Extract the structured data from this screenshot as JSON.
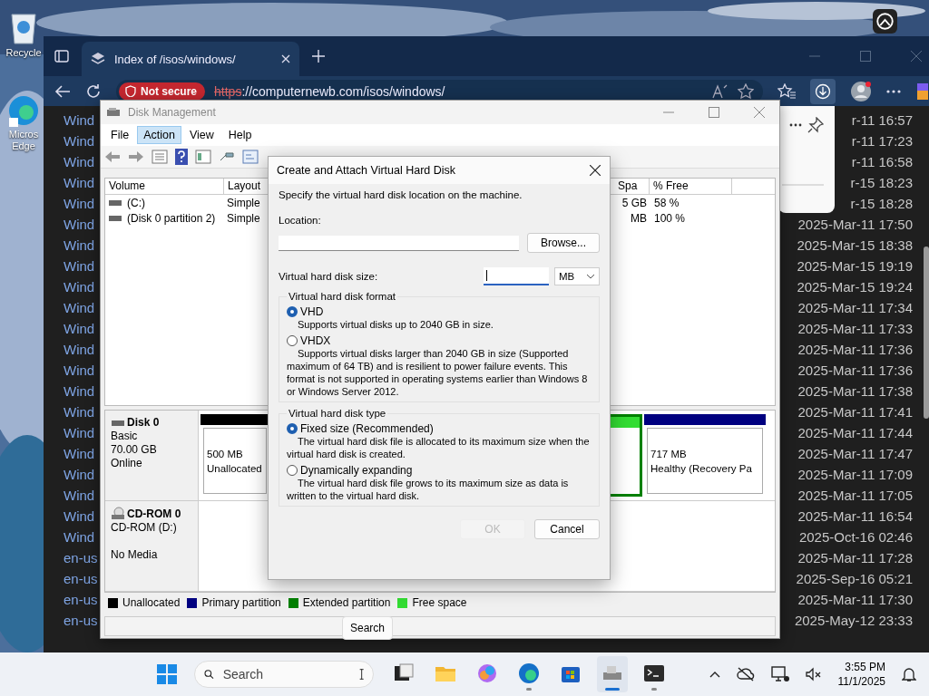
{
  "desktop": {
    "icons": [
      {
        "label": "Recycle"
      },
      {
        "label": "Micros Edge"
      }
    ]
  },
  "browser": {
    "tab_title": "Index of /isos/windows/",
    "security_badge": "Not secure",
    "url_scheme": "https",
    "url_rest": "://computernewb.com/isos/windows/",
    "listing": {
      "names": [
        "Wind",
        "Wind",
        "Wind",
        "Wind",
        "Wind",
        "Wind",
        "Wind",
        "Wind",
        "Wind",
        "Wind",
        "Wind",
        "Wind",
        "Wind",
        "Wind",
        "Wind",
        "Wind",
        "Wind",
        "Wind",
        "Wind",
        "Wind",
        "Wind",
        "en-us",
        "en-us",
        "en-us",
        "en-us"
      ],
      "dates": [
        "r-11 16:57",
        "r-11 17:23",
        "r-11 16:58",
        "r-15 18:23",
        "r-15 18:28",
        "2025-Mar-11 17:50",
        "2025-Mar-15 18:38",
        "2025-Mar-15 19:19",
        "2025-Mar-15 19:24",
        "2025-Mar-11 17:34",
        "2025-Mar-11 17:33",
        "2025-Mar-11 17:36",
        "2025-Mar-11 17:36",
        "2025-Mar-11 17:38",
        "2025-Mar-11 17:41",
        "2025-Mar-11 17:44",
        "2025-Mar-11 17:47",
        "2025-Mar-11 17:09",
        "2025-Mar-11 17:05",
        "2025-Mar-11 16:54",
        "2025-Oct-16 02:46",
        "2025-Mar-11 17:28",
        "2025-Sep-16 05:21",
        "2025-Mar-11 17:30",
        "2025-May-12 23:33"
      ]
    }
  },
  "disk_management": {
    "title": "Disk Management",
    "menu": [
      {
        "label": "File",
        "selected": false
      },
      {
        "label": "Action",
        "selected": true
      },
      {
        "label": "View",
        "selected": false
      },
      {
        "label": "Help",
        "selected": false
      }
    ],
    "volume_table": {
      "columns": [
        "Volume",
        "Layout"
      ],
      "rows": [
        {
          "volume": "(C:)",
          "layout": "Simple"
        },
        {
          "volume": "(Disk 0 partition 2)",
          "layout": "Simple"
        }
      ]
    },
    "right_columns": [
      "Spa",
      "% Free"
    ],
    "right_rows": [
      [
        "5 GB",
        "58 %"
      ],
      [
        "MB",
        "100 %"
      ]
    ],
    "disks": [
      {
        "kind": "disk",
        "name": "Disk 0",
        "lines": [
          "Basic",
          "70.00 GB",
          "Online"
        ],
        "first_partition": {
          "size": "500 MB",
          "status": "Unallocated",
          "color": "#000000"
        },
        "last_partition": {
          "size": "717 MB",
          "status": "Healthy (Recovery Pa",
          "color": "#000080"
        }
      },
      {
        "kind": "cdrom",
        "name": "CD-ROM 0",
        "lines": [
          "CD-ROM (D:)",
          "No Media"
        ]
      }
    ],
    "legend": [
      {
        "label": "Unallocated",
        "color": "#000000"
      },
      {
        "label": "Primary partition",
        "color": "#000080"
      },
      {
        "label": "Extended partition",
        "color": "#008000"
      },
      {
        "label": "Free space",
        "color": "#33dd33"
      }
    ],
    "tooltip": "Search"
  },
  "dialog": {
    "title": "Create and Attach Virtual Hard Disk",
    "instruction": "Specify the virtual hard disk location on the machine.",
    "location_label": "Location:",
    "browse": "Browse...",
    "size_label": "Virtual hard disk size:",
    "unit": "MB",
    "format": {
      "legend": "Virtual hard disk format",
      "options": [
        {
          "label": "VHD",
          "description": "Supports virtual disks up to 2040 GB in size.",
          "selected": true
        },
        {
          "label": "VHDX",
          "description": "Supports virtual disks larger than 2040 GB in size (Supported maximum of 64 TB) and is resilient to power failure events. This format is not supported in operating systems earlier than Windows 8 or Windows Server 2012.",
          "selected": false
        }
      ]
    },
    "type": {
      "legend": "Virtual hard disk type",
      "options": [
        {
          "label": "Fixed size (Recommended)",
          "description": "The virtual hard disk file is allocated to its maximum size when the virtual hard disk is created.",
          "selected": true
        },
        {
          "label": "Dynamically expanding",
          "description": "The virtual hard disk file grows to its maximum size as data is written to the virtual hard disk.",
          "selected": false
        }
      ]
    },
    "buttons": [
      {
        "label": "OK",
        "disabled": true
      },
      {
        "label": "Cancel",
        "disabled": false
      }
    ]
  },
  "taskbar": {
    "search_placeholder": "Search",
    "time": "3:55 PM",
    "date": "11/1/2025",
    "apps": [
      {
        "running": false,
        "active": false
      },
      {
        "running": false,
        "active": false
      },
      {
        "running": false,
        "active": false
      },
      {
        "running": true,
        "active": false
      },
      {
        "running": false,
        "active": false
      },
      {
        "running": true,
        "active": true
      },
      {
        "running": true,
        "active": false
      }
    ]
  }
}
